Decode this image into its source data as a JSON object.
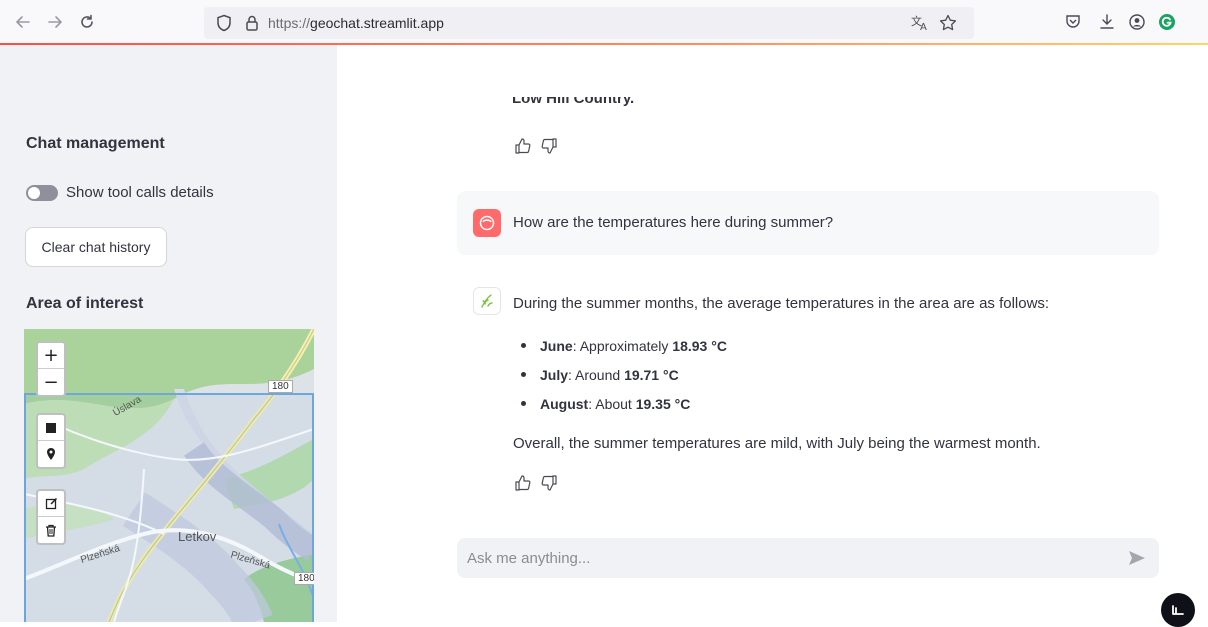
{
  "browser": {
    "url_prefix": "https://",
    "url_host": "geochat.streamlit.app",
    "colors": {
      "accent_start": "#ff4b4b",
      "accent_end": "#ffd36b",
      "extension_green": "#1aa260"
    }
  },
  "sidebar": {
    "chat_heading": "Chat management",
    "toggle_label": "Show tool calls details",
    "toggle_on": false,
    "clear_button": "Clear chat history",
    "area_heading": "Area of interest",
    "map": {
      "zoom_in": "+",
      "zoom_out": "−",
      "labels": {
        "town": "Letkov",
        "street_1": "Plzeňská",
        "street_2": "Plzeňská",
        "river": "Úslava",
        "road_number_1": "180",
        "road_number_2": "180"
      }
    }
  },
  "chat": {
    "clipped_previous_text": "Low Hill Country.",
    "user_message": "How are the temperatures here during summer?",
    "bot_intro": "During the summer months, the average temperatures in the area are as follows:",
    "bot_list": [
      {
        "month": "June",
        "text": ": Approximately ",
        "value": "18.93 °C"
      },
      {
        "month": "July",
        "text": ": Around ",
        "value": "19.71 °C"
      },
      {
        "month": "August",
        "text": ": About ",
        "value": "19.35 °C"
      }
    ],
    "bot_outro": "Overall, the summer temperatures are mild, with July being the warmest month.",
    "input_placeholder": "Ask me anything...",
    "colors": {
      "user_avatar": "#ff6a6a",
      "bot_avatar_icon": "#7bc142"
    }
  }
}
